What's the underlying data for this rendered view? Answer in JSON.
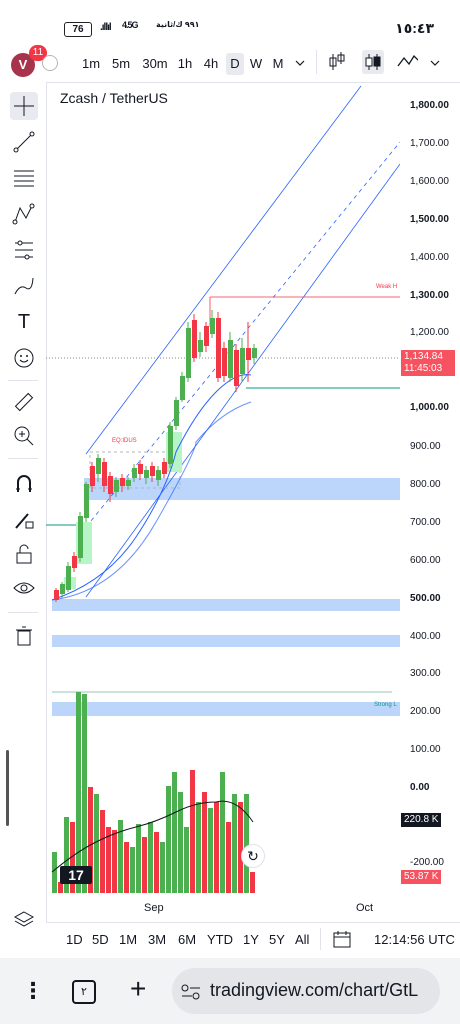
{
  "status_bar": {
    "battery": "76",
    "network": "4.5G",
    "signal_text": "٩٩١ ك/ثانية",
    "clock": "١٥:٤٣"
  },
  "toolbar": {
    "avatar_letter": "V",
    "notification_count": "11",
    "timeframes": [
      "1m",
      "5m",
      "30m",
      "1h",
      "4h",
      "D",
      "W",
      "M"
    ],
    "active_timeframe": "D"
  },
  "chart": {
    "symbol_title": "Zcash / TetherUS",
    "annotations": {
      "weak_high": "Weak H",
      "equilibrium": "EQ:IDUS",
      "strong": "Strong L"
    },
    "price_labels": [
      "1,800.00",
      "1,700.00",
      "1,600.00",
      "1,500.00",
      "1,400.00",
      "1,300.00",
      "1,200.00",
      "1,000.00",
      "900.00",
      "800.00",
      "700.00",
      "600.00",
      "500.00",
      "400.00",
      "300.00",
      "200.00",
      "100.00",
      "0.00",
      "-200.00"
    ],
    "current_price": "1,134.84",
    "countdown": "11:45:03",
    "volume_value": "220.8 K",
    "volume_ma_value": "53.87 K",
    "time_labels": [
      "Sep",
      "Oct"
    ],
    "colors": {
      "up": "#4caf50",
      "down": "#f23645",
      "channel": "#2962ff",
      "zone": "#bbd5fb",
      "price_badge": "#f7525f"
    }
  },
  "bottom_bar": {
    "ranges": [
      "1D",
      "5D",
      "1M",
      "3M",
      "6M",
      "YTD",
      "1Y",
      "5Y",
      "All"
    ],
    "clock": "12:14:56 UTC"
  },
  "browser": {
    "tab_count": "٢",
    "url": "tradingview.com/chart/GtL"
  }
}
